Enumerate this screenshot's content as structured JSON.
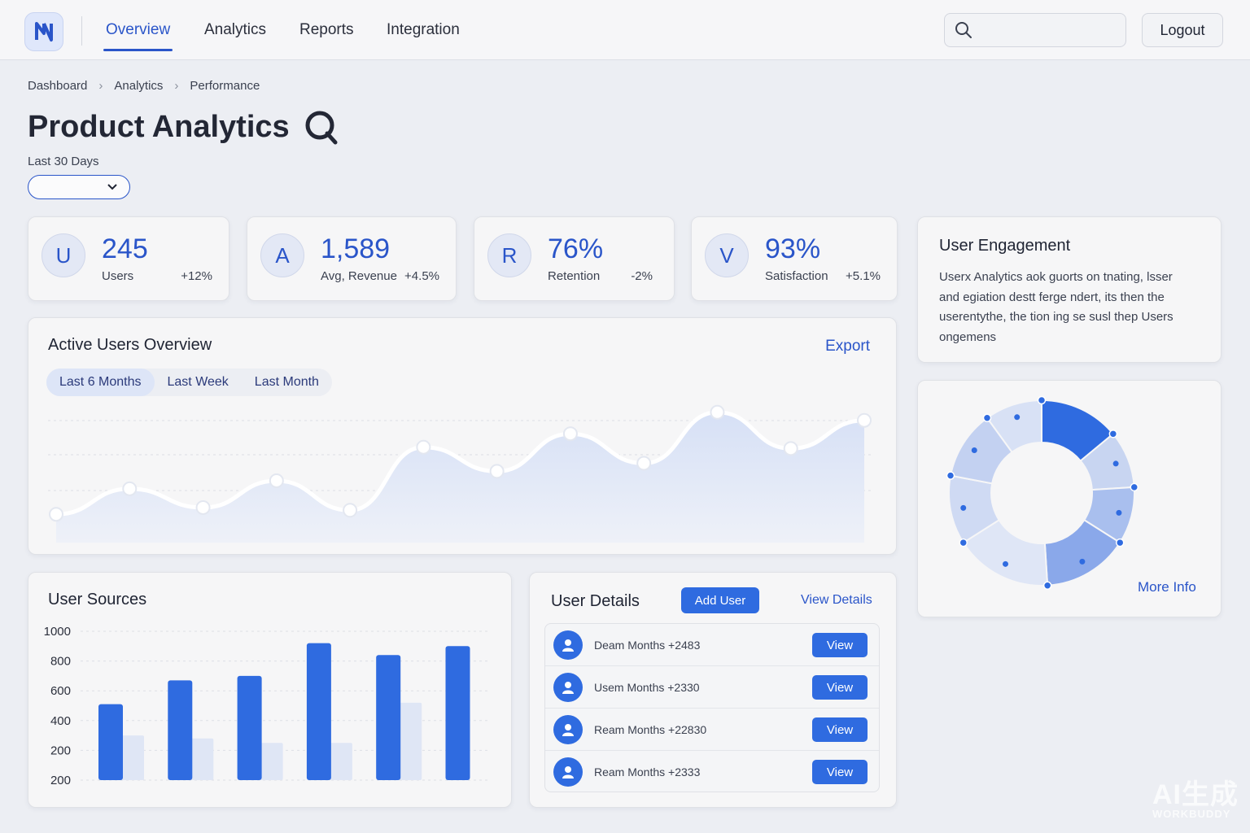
{
  "nav": {
    "tabs": [
      {
        "label": "Overview",
        "active": true
      },
      {
        "label": "Analytics"
      },
      {
        "label": "Reports"
      },
      {
        "label": "Integration"
      }
    ],
    "logout_label": "Logout",
    "search": {
      "placeholder": "",
      "icon": "search-icon"
    },
    "logo_icon": "n-logo-icon"
  },
  "breadcrumb": [
    "Dashboard",
    "Analytics",
    "Performance"
  ],
  "page": {
    "title": "Product Analytics",
    "period_label": "Last 30 Days",
    "period_value": ""
  },
  "kpis": [
    {
      "initial": "U",
      "value": "245",
      "label": "Users",
      "delta": "+12%"
    },
    {
      "initial": "A",
      "value": "1,589",
      "label": "Avg, Revenue",
      "delta": "+4.5%"
    },
    {
      "initial": "R",
      "value": "76%",
      "label": "Retention",
      "delta": "-2%"
    },
    {
      "initial": "V",
      "value": "93%",
      "label": "Satisfaction",
      "delta": "+5.1%"
    }
  ],
  "engagement": {
    "title": "User Engagement",
    "lines": [
      "Userx Analytics aok guorts on tnating, lsser",
      "and egiation destt ferge ndert, its then the",
      "userentythe, the tion ing se susl thep Users",
      "ongemens"
    ]
  },
  "active_users": {
    "title": "Active Users Overview",
    "export_label": "Export",
    "range_tabs": [
      {
        "label": "Last 6 Months",
        "active": true
      },
      {
        "label": "Last Week"
      },
      {
        "label": "Last Month"
      }
    ]
  },
  "donut": {
    "more_info_label": "More Info"
  },
  "user_sources": {
    "title": "User Sources"
  },
  "user_details": {
    "title": "User Details",
    "add_label": "Add User",
    "view_details_label": "View Details",
    "rows": [
      {
        "name": "Deam Months +2483",
        "action": "View"
      },
      {
        "name": "Usem Months  +2330",
        "action": "View"
      },
      {
        "name": "Ream Months  +22830",
        "action": "View"
      },
      {
        "name": "Ream Months +2333",
        "action": "View"
      }
    ]
  },
  "watermark": {
    "line1": "AI生成",
    "line2": "WORKBUDDY"
  },
  "colors": {
    "accent": "#2a55c9",
    "bar": "#2f6be0",
    "bar_ghost": "#dfe6f5",
    "area": "#dfe6f6"
  },
  "chart_data": [
    {
      "type": "area",
      "title": "Active Users Overview",
      "x": [
        1,
        2,
        3,
        4,
        5,
        6,
        7,
        8,
        9,
        10,
        11,
        12
      ],
      "series": [
        {
          "values": [
            12,
            31,
            17,
            37,
            15,
            62,
            44,
            72,
            50,
            88,
            61,
            82
          ]
        }
      ],
      "ylim": [
        0,
        100
      ],
      "grid": true
    },
    {
      "type": "bar",
      "title": "User Sources",
      "categories": [
        "1",
        "2",
        "3",
        "4",
        "5",
        "6"
      ],
      "ytick_labels": [
        "1000",
        "800",
        "600",
        "400",
        "200",
        "200"
      ],
      "series": [
        {
          "values": [
            510,
            670,
            700,
            920,
            840,
            900
          ]
        },
        {
          "values": [
            300,
            280,
            250,
            250,
            520,
            0
          ]
        }
      ],
      "ylim": [
        0,
        1000
      ],
      "grid": true
    },
    {
      "type": "pie",
      "values": [
        14,
        10,
        10,
        15,
        17,
        12,
        12,
        10
      ],
      "highlight_index": 0
    }
  ]
}
